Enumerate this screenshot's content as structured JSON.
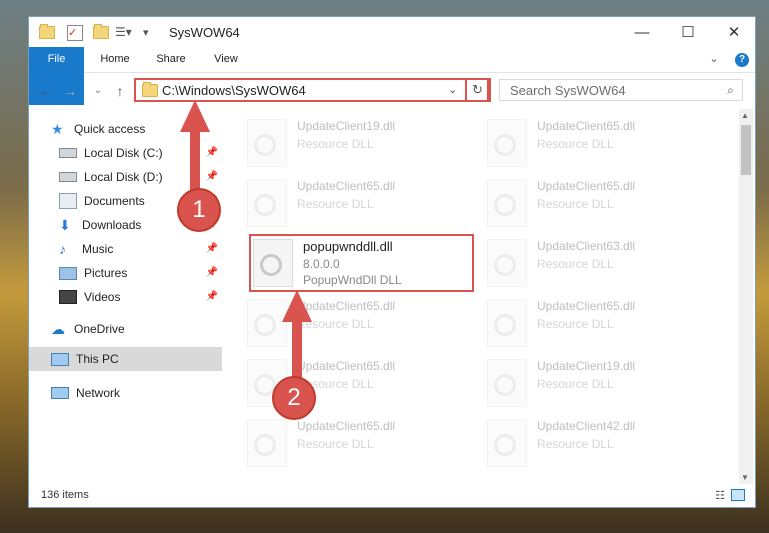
{
  "window": {
    "title": "SysWOW64",
    "minimize": "—",
    "maximize": "☐",
    "close": "✕"
  },
  "ribbon": {
    "tabs": [
      "File",
      "Home",
      "Share",
      "View"
    ],
    "help": "?"
  },
  "address": {
    "path": "C:\\Windows\\SysWOW64",
    "search_placeholder": "Search SysWOW64"
  },
  "sidebar": {
    "items": [
      {
        "label": "Quick access",
        "pinned": false
      },
      {
        "label": "Local Disk (C:)",
        "pinned": true
      },
      {
        "label": "Local Disk (D:)",
        "pinned": true
      },
      {
        "label": "Documents",
        "pinned": true
      },
      {
        "label": "Downloads",
        "pinned": true
      },
      {
        "label": "Music",
        "pinned": true
      },
      {
        "label": "Pictures",
        "pinned": true
      },
      {
        "label": "Videos",
        "pinned": true
      },
      {
        "label": "OneDrive",
        "pinned": false
      },
      {
        "label": "This PC",
        "pinned": false
      },
      {
        "label": "Network",
        "pinned": false
      }
    ]
  },
  "files": [
    {
      "name": "UpdateClient19.dll",
      "desc": "Resource DLL"
    },
    {
      "name": "UpdateClient65.dll",
      "desc": "Resource DLL"
    },
    {
      "name": "UpdateClient65.dll",
      "desc": "Resource DLL"
    },
    {
      "name": "UpdateClient65.dll",
      "desc": "Resource DLL"
    },
    {
      "name": "popupwnddll.dll",
      "version": "8.0.0.0",
      "desc": "PopupWndDll DLL"
    },
    {
      "name": "UpdateClient63.dll",
      "desc": "Resource DLL"
    },
    {
      "name": "UpdateClient65.dll",
      "desc": "Resource DLL"
    },
    {
      "name": "UpdateClient65.dll",
      "desc": "Resource DLL"
    },
    {
      "name": "UpdateClient65.dll",
      "desc": "Resource DLL"
    },
    {
      "name": "UpdateClient19.dll",
      "desc": "Resource DLL"
    },
    {
      "name": "UpdateClient65.dll",
      "desc": "Resource DLL"
    },
    {
      "name": "UpdateClient42.dll",
      "desc": "Resource DLL"
    }
  ],
  "status": {
    "count": "136 items"
  },
  "annotations": {
    "step1": "1",
    "step2": "2"
  },
  "colors": {
    "accent": "#1979ca",
    "highlight": "#d9534f"
  }
}
